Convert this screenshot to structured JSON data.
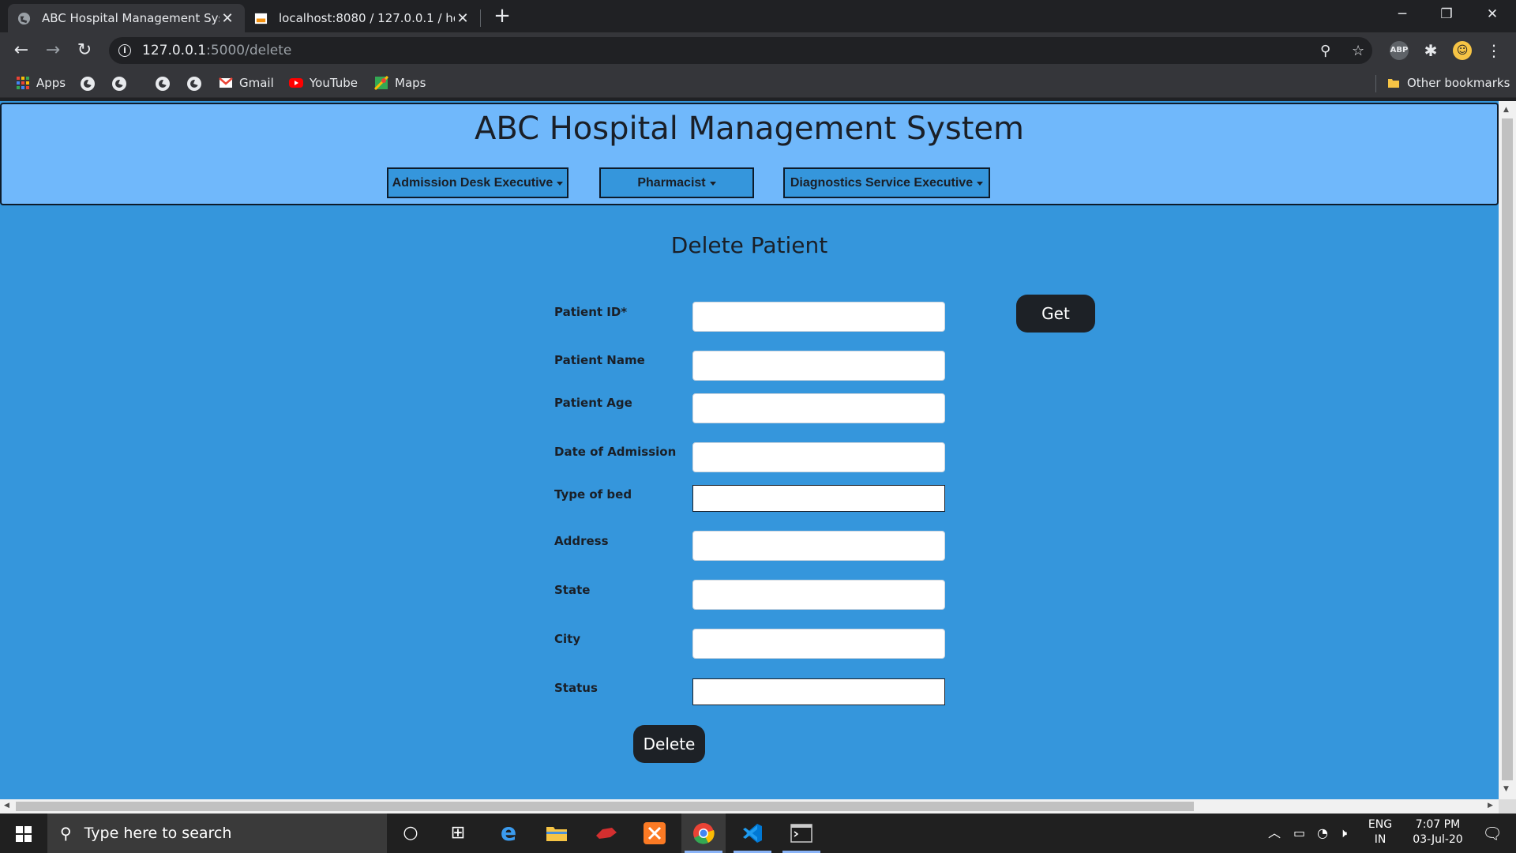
{
  "browser": {
    "tabs": [
      {
        "title": "ABC Hospital Management Syste",
        "active": true
      },
      {
        "title": "localhost:8080 / 127.0.0.1 / hospi",
        "active": false
      }
    ],
    "url_host": "127.0.0.1",
    "url_path": ":5000/delete",
    "bookmarks": {
      "apps": "Apps",
      "gmail": "Gmail",
      "youtube": "YouTube",
      "maps": "Maps",
      "other": "Other bookmarks"
    },
    "extension_abp": "ABP"
  },
  "app": {
    "title": "ABC Hospital Management System",
    "menus": [
      {
        "label": "Admission Desk Executive"
      },
      {
        "label": "Pharmacist"
      },
      {
        "label": "Diagnostics Service Executive"
      }
    ]
  },
  "form": {
    "title": "Delete Patient",
    "fields": [
      {
        "label": "Patient ID*",
        "value": ""
      },
      {
        "label": "Patient Name",
        "value": ""
      },
      {
        "label": "Patient Age",
        "value": ""
      },
      {
        "label": "Date of Admission",
        "value": ""
      },
      {
        "label": "Type of bed",
        "value": ""
      },
      {
        "label": "Address",
        "value": ""
      },
      {
        "label": "State",
        "value": ""
      },
      {
        "label": "City",
        "value": ""
      },
      {
        "label": "Status",
        "value": ""
      }
    ],
    "get_label": "Get",
    "delete_label": "Delete"
  },
  "taskbar": {
    "search_placeholder": "Type here to search",
    "lang_top": "ENG",
    "lang_bottom": "IN",
    "time": "7:07 PM",
    "date": "03-Jul-20"
  },
  "colors": {
    "page_bg": "#3596dc",
    "header_bg": "#70b8fb",
    "dark_button": "#1d2126"
  }
}
